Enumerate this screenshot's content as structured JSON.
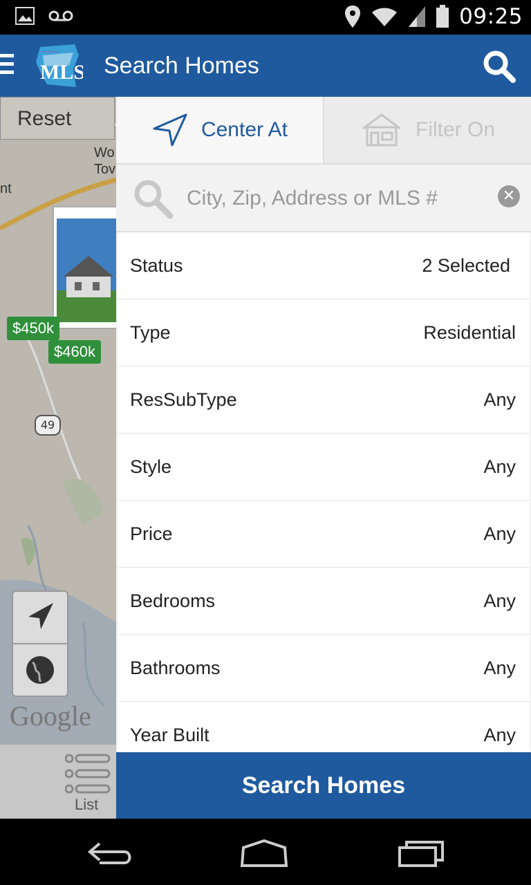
{
  "status_bar": {
    "time": "09:25",
    "icons": [
      "image-icon",
      "voicemail-icon",
      "location-icon",
      "wifi-icon",
      "signal-icon",
      "battery-icon"
    ]
  },
  "app_bar": {
    "title": "Search Homes",
    "logo_text": "MLS",
    "icons": [
      "menu-icon",
      "search-icon"
    ]
  },
  "map": {
    "reset_label": "Reset",
    "labels": [
      "Wo",
      "Tov",
      "nt"
    ],
    "price_tags": [
      "$450k",
      "$460k"
    ],
    "route_number": "49",
    "google_text": "Google",
    "list_label": "List"
  },
  "tabs": [
    {
      "label": "Center At",
      "icon": "navigation-arrow-icon",
      "active": true
    },
    {
      "label": "Filter On",
      "icon": "house-icon",
      "active": false
    }
  ],
  "search": {
    "placeholder": "City, Zip, Address or MLS #",
    "value": ""
  },
  "filters": [
    {
      "label": "Status",
      "value": "2 Selected"
    },
    {
      "label": "Type",
      "value": "Residential"
    },
    {
      "label": "ResSubType",
      "value": "Any"
    },
    {
      "label": "Style",
      "value": "Any"
    },
    {
      "label": "Price",
      "value": "Any"
    },
    {
      "label": "Bedrooms",
      "value": "Any"
    },
    {
      "label": "Bathrooms",
      "value": "Any"
    },
    {
      "label": "Year Built",
      "value": "Any"
    }
  ],
  "submit_label": "Search Homes",
  "colors": {
    "brand_blue": "#1f5a9e",
    "price_tag_green": "#2f8f3a"
  }
}
